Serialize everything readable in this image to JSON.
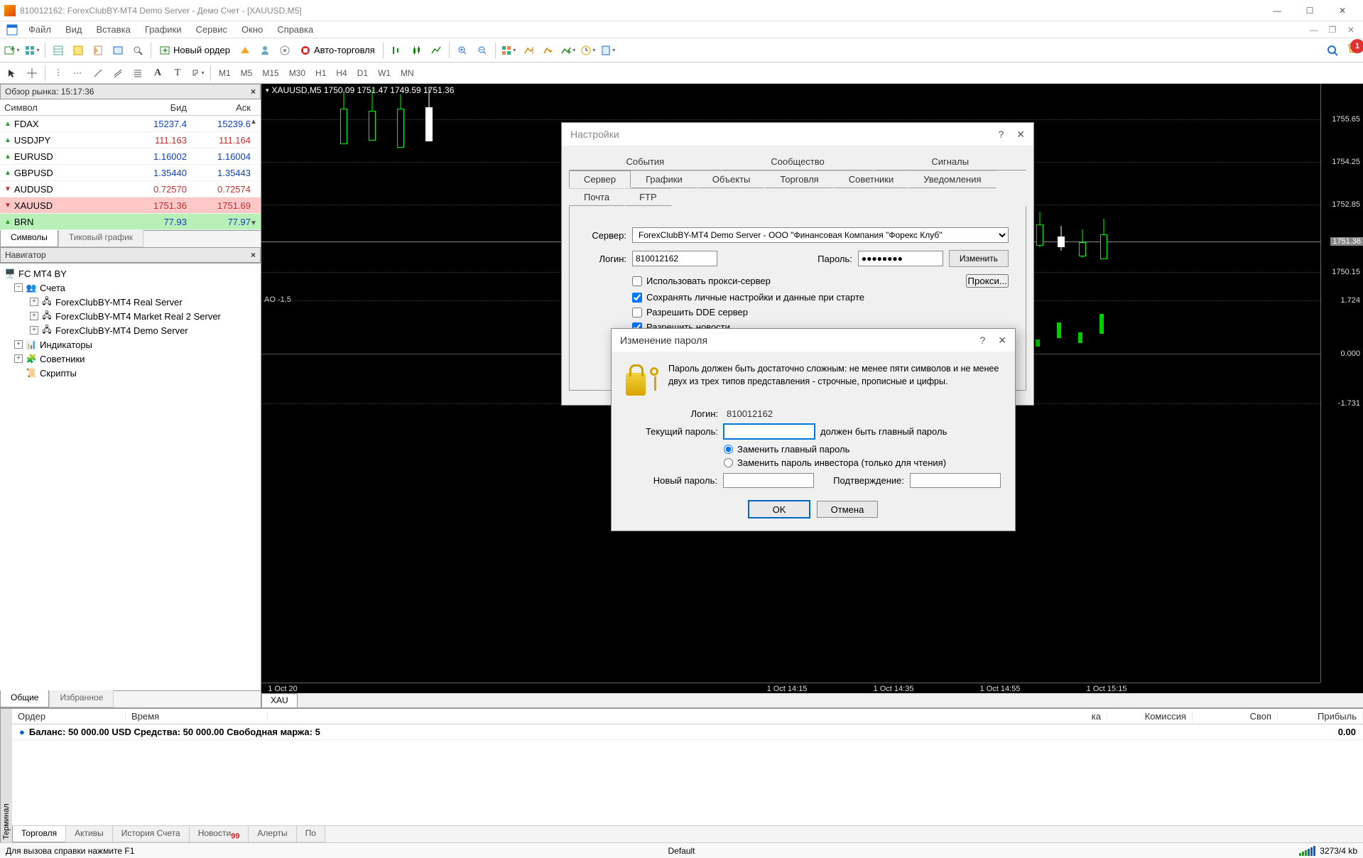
{
  "titlebar": {
    "text": "810012162: ForexClubBY-MT4 Demo Server - Демо Счет - [XAUUSD,M5]"
  },
  "menubar": {
    "file": "Файл",
    "view": "Вид",
    "insert": "Вставка",
    "charts": "Графики",
    "service": "Сервис",
    "window": "Окно",
    "help": "Справка"
  },
  "toolbar": {
    "new_order": "Новый ордер",
    "auto_trade": "Авто-торговля"
  },
  "timeframes": {
    "m1": "M1",
    "m5": "M5",
    "m15": "M15",
    "m30": "M30",
    "h1": "H1",
    "h4": "H4",
    "d1": "D1",
    "w1": "W1",
    "mn": "MN"
  },
  "tool_letters": {
    "a": "A",
    "t": "T"
  },
  "notif_count": "1",
  "market_watch": {
    "title": "Обзор рынка: 15:17:36",
    "cols": {
      "symbol": "Символ",
      "bid": "Бид",
      "ask": "Аск"
    },
    "rows": [
      {
        "sym": "FDAX",
        "bid": "15237.4",
        "ask": "15239.6",
        "dir": "up",
        "color": "blue"
      },
      {
        "sym": "USDJPY",
        "bid": "111.163",
        "ask": "111.164",
        "dir": "up",
        "color": "red"
      },
      {
        "sym": "EURUSD",
        "bid": "1.16002",
        "ask": "1.16004",
        "dir": "up",
        "color": "blue"
      },
      {
        "sym": "GBPUSD",
        "bid": "1.35440",
        "ask": "1.35443",
        "dir": "up",
        "color": "blue"
      },
      {
        "sym": "AUDUSD",
        "bid": "0.72570",
        "ask": "0.72574",
        "dir": "dn",
        "color": "red"
      },
      {
        "sym": "XAUUSD",
        "bid": "1751.36",
        "ask": "1751.69",
        "dir": "dn",
        "color": "red",
        "row": "pink"
      },
      {
        "sym": "BRN",
        "bid": "77.93",
        "ask": "77.97",
        "dir": "up",
        "color": "blue",
        "row": "green"
      }
    ],
    "tabs": {
      "symbols": "Символы",
      "tick": "Тиковый график"
    }
  },
  "navigator": {
    "title": "Навигатор",
    "root": "FC MT4 BY",
    "accounts": "Счета",
    "srv1": "ForexClubBY-MT4 Real Server",
    "srv2": "ForexClubBY-MT4 Market Real 2 Server",
    "srv3": "ForexClubBY-MT4 Demo Server",
    "indicators": "Индикаторы",
    "experts": "Советники",
    "scripts": "Скрипты",
    "tabs": {
      "common": "Общие",
      "fav": "Избранное"
    }
  },
  "chart": {
    "header": "XAUUSD,M5  1750.09 1751.47 1749.59 1751.36",
    "tab": "XAU",
    "ao": "AO -1.5",
    "y": [
      "1755.65",
      "1754.25",
      "1752.85",
      "1751.36",
      "1750.15",
      "1.724",
      "0.000",
      "-1.731"
    ],
    "x": [
      "1 Oct 20",
      "1 Oct 14:15",
      "1 Oct 14:35",
      "1 Oct 14:55",
      "1 Oct 15:15"
    ]
  },
  "settings": {
    "title": "Настройки",
    "tabs": {
      "events": "События",
      "community": "Сообщество",
      "signals": "Сигналы",
      "server": "Сервер",
      "charts": "Графики",
      "objects": "Объекты",
      "trade": "Торговля",
      "experts": "Советники",
      "notifications": "Уведомления",
      "mail": "Почта",
      "ftp": "FTP"
    },
    "labels": {
      "server": "Сервер:",
      "login": "Логин:",
      "password": "Пароль:"
    },
    "server_value": "ForexClubBY-MT4 Demo Server - ООО \"Финансовая Компания \"Форекс Клуб\"",
    "login_value": "810012162",
    "pwd_mask": "●●●●●●●●",
    "btn_change": "Изменить",
    "btn_proxy": "Прокси...",
    "chk_proxy": "Использовать прокси-сервер",
    "chk_keep": "Сохранять личные настройки и данные при старте",
    "chk_dde": "Разрешить DDE сервер",
    "chk_news": "Разрешить новости"
  },
  "change_pwd": {
    "title": "Изменение пароля",
    "desc": "Пароль должен быть достаточно сложным: не менее пяти символов и не менее двух из трех типов представления - строчные, прописные и цифры.",
    "login_l": "Логин:",
    "login_v": "810012162",
    "cur_l": "Текущий пароль:",
    "cur_hint": "должен быть главный пароль",
    "r1": "Заменить главный пароль",
    "r2": "Заменить пароль инвестора (только для чтения)",
    "new_l": "Новый пароль:",
    "conf_l": "Подтверждение:",
    "ok": "OK",
    "cancel": "Отмена"
  },
  "terminal": {
    "label": "Терминал",
    "cols": {
      "order": "Ордер",
      "time": "Время",
      "commission": "Комиссия",
      "swap": "Своп",
      "profit": "Прибыль"
    },
    "balance_line": "Баланс: 50 000.00 USD  Средства: 50 000.00  Свободная маржа: 5",
    "profit": "0.00",
    "tabs": {
      "trade": "Торговля",
      "assets": "Активы",
      "history": "История Счета",
      "news": "Новости",
      "alerts": "Алерты",
      "mail": "По"
    },
    "news_count": "99",
    "hidden_col": "ка"
  },
  "statusbar": {
    "help": "Для вызова справки нажмите F1",
    "profile": "Default",
    "conn": "3273/4 kb"
  }
}
